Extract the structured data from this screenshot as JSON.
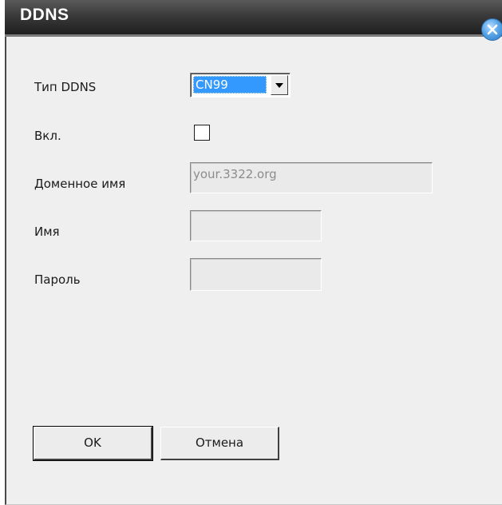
{
  "window": {
    "title": "DDNS"
  },
  "form": {
    "ddns_type": {
      "label": "Тип DDNS",
      "value": "CN99"
    },
    "enable": {
      "label": "Вкл.",
      "checked": false
    },
    "domain": {
      "label": "Доменное имя",
      "value": "your.3322.org"
    },
    "username": {
      "label": "Имя",
      "value": ""
    },
    "password": {
      "label": "Пароль",
      "value": ""
    }
  },
  "buttons": {
    "ok_label": "OK",
    "cancel_label": "Отмена"
  },
  "icons": {
    "close": "close-icon",
    "dropdown": "chevron-down-icon"
  },
  "colors": {
    "titlebar": "#2d2d2d",
    "dialog_bg": "#efefef",
    "selection": "#3399ff",
    "close_button": "#4a9ae0"
  }
}
